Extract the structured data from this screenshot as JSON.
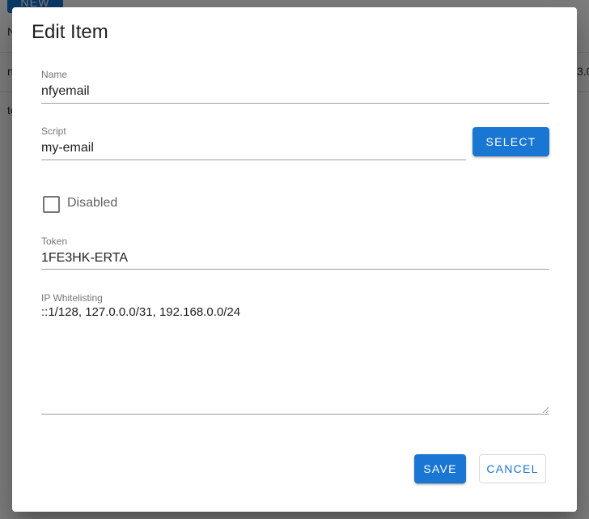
{
  "background": {
    "new_button_label": "NEW",
    "header_fragment": "N",
    "row_fragment_left": "n",
    "row_fragment_right": "3.0",
    "row2_fragment": "te"
  },
  "dialog": {
    "title": "Edit Item",
    "name": {
      "label": "Name",
      "value": "nfyemail"
    },
    "script": {
      "label": "Script",
      "value": "my-email",
      "select_button_label": "SELECT"
    },
    "disabled": {
      "label": "Disabled",
      "checked": false
    },
    "token": {
      "label": "Token",
      "value": "1FE3HK-ERTA"
    },
    "ip_whitelisting": {
      "label": "IP Whitelisting",
      "value": "::1/128, 127.0.0.0/31, 192.168.0.0/24"
    },
    "save_label": "SAVE",
    "cancel_label": "CANCEL"
  },
  "colors": {
    "primary": "#1976d2",
    "scrim": "rgba(0,0,0,0.5)",
    "text": "#212121",
    "label": "#757575"
  }
}
